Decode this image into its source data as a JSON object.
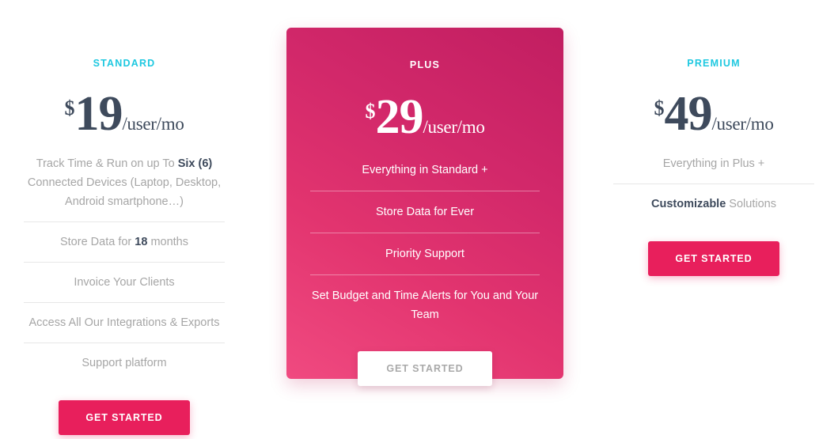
{
  "page": {
    "background_color": "#ffffff",
    "accent_pink": "#e81f5c",
    "accent_cyan": "#1ec8e0",
    "price_color": "#3e4a5c"
  },
  "plans": [
    {
      "id": "standard",
      "name": "STANDARD",
      "currency": "$",
      "amount": "19",
      "period": "/user/mo",
      "featured": false,
      "features": [
        {
          "prefix": "Track Time & Run on up To ",
          "strong": "Six (6)",
          "suffix": " Connected Devices (Laptop, Desktop, Android smartphone…)"
        },
        {
          "prefix": "Store Data for ",
          "strong": "18",
          "suffix": " months"
        },
        {
          "prefix": "Invoice Your Clients",
          "strong": "",
          "suffix": ""
        },
        {
          "prefix": "Access All Our Integrations & Exports",
          "strong": "",
          "suffix": ""
        },
        {
          "prefix": "Support platform",
          "strong": "",
          "suffix": ""
        }
      ],
      "cta_label": "GET STARTED"
    },
    {
      "id": "plus",
      "name": "PLUS",
      "currency": "$",
      "amount": "29",
      "period": "/user/mo",
      "featured": true,
      "features": [
        {
          "prefix": "Everything in Standard +",
          "strong": "",
          "suffix": ""
        },
        {
          "prefix": "Store Data for Ever",
          "strong": "",
          "suffix": ""
        },
        {
          "prefix": "Priority Support",
          "strong": "",
          "suffix": ""
        },
        {
          "prefix": "Set Budget and Time Alerts for You and Your Team",
          "strong": "",
          "suffix": ""
        }
      ],
      "cta_label": "GET STARTED"
    },
    {
      "id": "premium",
      "name": "PREMIUM",
      "currency": "$",
      "amount": "49",
      "period": "/user/mo",
      "featured": false,
      "features": [
        {
          "prefix": "Everything in Plus +",
          "strong": "",
          "suffix": ""
        },
        {
          "prefix": "",
          "strong": "Customizable",
          "suffix": " Solutions"
        }
      ],
      "cta_label": "GET STARTED"
    }
  ]
}
